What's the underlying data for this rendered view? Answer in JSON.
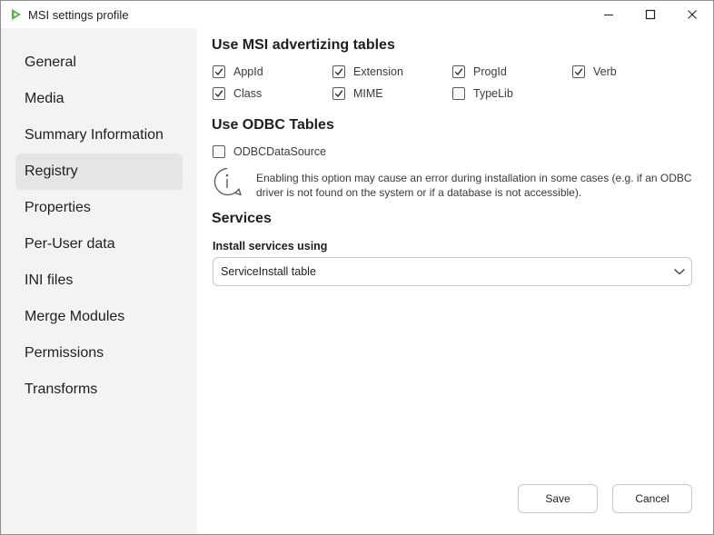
{
  "window": {
    "title": "MSI settings profile"
  },
  "sidebar": {
    "items": [
      {
        "label": "General",
        "active": false
      },
      {
        "label": "Media",
        "active": false
      },
      {
        "label": "Summary Information",
        "active": false
      },
      {
        "label": "Registry",
        "active": true
      },
      {
        "label": "Properties",
        "active": false
      },
      {
        "label": "Per-User data",
        "active": false
      },
      {
        "label": "INI files",
        "active": false
      },
      {
        "label": "Merge Modules",
        "active": false
      },
      {
        "label": "Permissions",
        "active": false
      },
      {
        "label": "Transforms",
        "active": false
      }
    ]
  },
  "advertising": {
    "title": "Use MSI advertizing tables",
    "options": [
      {
        "label": "AppId",
        "checked": true
      },
      {
        "label": "Extension",
        "checked": true
      },
      {
        "label": "ProgId",
        "checked": true
      },
      {
        "label": "Verb",
        "checked": true
      },
      {
        "label": "Class",
        "checked": true
      },
      {
        "label": "MIME",
        "checked": true
      },
      {
        "label": "TypeLib",
        "checked": false
      }
    ]
  },
  "odbc": {
    "title": "Use ODBC Tables",
    "option": {
      "label": "ODBCDataSource",
      "checked": false
    },
    "info": "Enabling this option may cause an error during installation in some cases (e.g. if an ODBC driver is not found on the system or if a database is not accessible)."
  },
  "services": {
    "title": "Services",
    "field_label": "Install services using",
    "selected": "ServiceInstall table"
  },
  "footer": {
    "save_label": "Save",
    "cancel_label": "Cancel"
  },
  "icons": {
    "app": "app-logo-icon",
    "info": "info-icon",
    "chevron": "chevron-down-icon"
  },
  "colors": {
    "accent_logo": "#5bb14a",
    "sidebar_bg": "#f3f3f3",
    "active_item_bg": "#e5e5e5"
  }
}
